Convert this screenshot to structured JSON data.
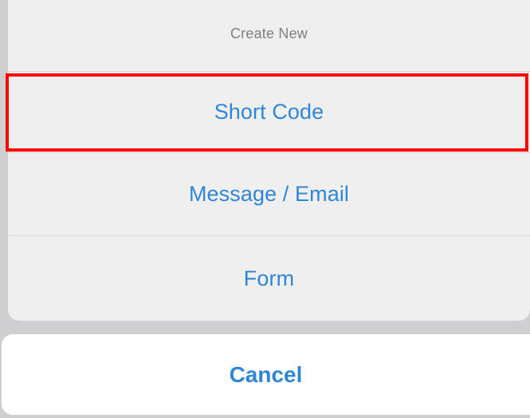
{
  "sheet": {
    "title": "Create New",
    "options": [
      {
        "label": "Short Code"
      },
      {
        "label": "Message / Email"
      },
      {
        "label": "Form"
      }
    ],
    "highlighted_option": "Short Code",
    "highlight_color": "#ff0000"
  },
  "cancel": {
    "label": "Cancel"
  },
  "colors": {
    "accent": "#2f86d8",
    "title_text": "#7f7f83",
    "sheet_background": "#efeff0",
    "backdrop": "#cfcfd1"
  }
}
